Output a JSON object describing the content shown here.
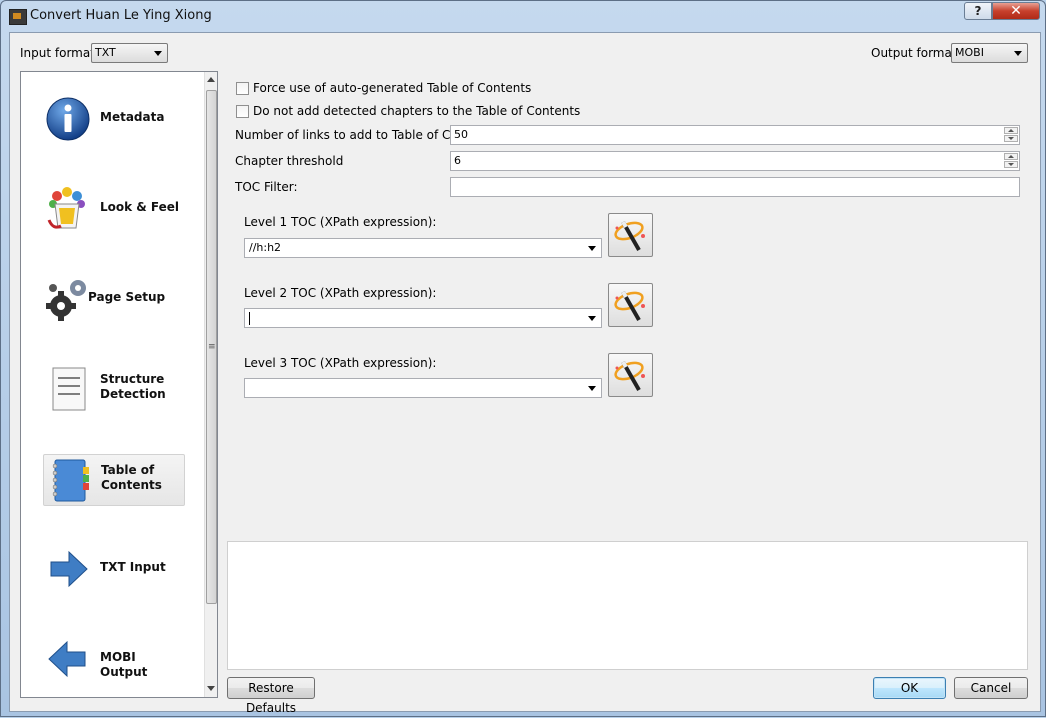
{
  "window": {
    "title": "Convert Huan Le Ying Xiong",
    "help_label": "?",
    "close_label": "✕"
  },
  "formats": {
    "input_label": "Input format:",
    "input_value": "TXT",
    "output_label": "Output format:",
    "output_value": "MOBI"
  },
  "sidebar": {
    "items": [
      {
        "label": "Metadata",
        "icon": "info-icon"
      },
      {
        "label": "Look & Feel",
        "icon": "paint-bucket-icon"
      },
      {
        "label": "Page Setup",
        "icon": "gears-icon"
      },
      {
        "label": "Structure Detection",
        "icon": "document-icon"
      },
      {
        "label": "Table of Contents",
        "icon": "notebook-icon",
        "active": true
      },
      {
        "label": "TXT Input",
        "icon": "arrow-right-icon"
      },
      {
        "label": "MOBI Output",
        "icon": "arrow-left-icon"
      }
    ]
  },
  "toc": {
    "force_toc_label": "Force use of auto-generated Table of Contents",
    "no_chapters_label": "Do not add detected chapters to the Table of Contents",
    "max_links_label": "Number of links to add to Table of Contents",
    "max_links_value": "50",
    "chapter_threshold_label": "Chapter threshold",
    "chapter_threshold_value": "6",
    "toc_filter_label": "TOC Filter:",
    "toc_filter_value": "",
    "level1_label": "Level 1 TOC (XPath expression):",
    "level1_value": "//h:h2",
    "level2_label": "Level 2 TOC (XPath expression):",
    "level2_value": "",
    "level3_label": "Level 3 TOC (XPath expression):",
    "level3_value": ""
  },
  "buttons": {
    "restore": "Restore Defaults",
    "ok": "OK",
    "cancel": "Cancel"
  },
  "colors": {
    "accent": "#3c7fb1",
    "info_blue": "#1f5fa8",
    "arrow_blue": "#3f7dc4"
  }
}
